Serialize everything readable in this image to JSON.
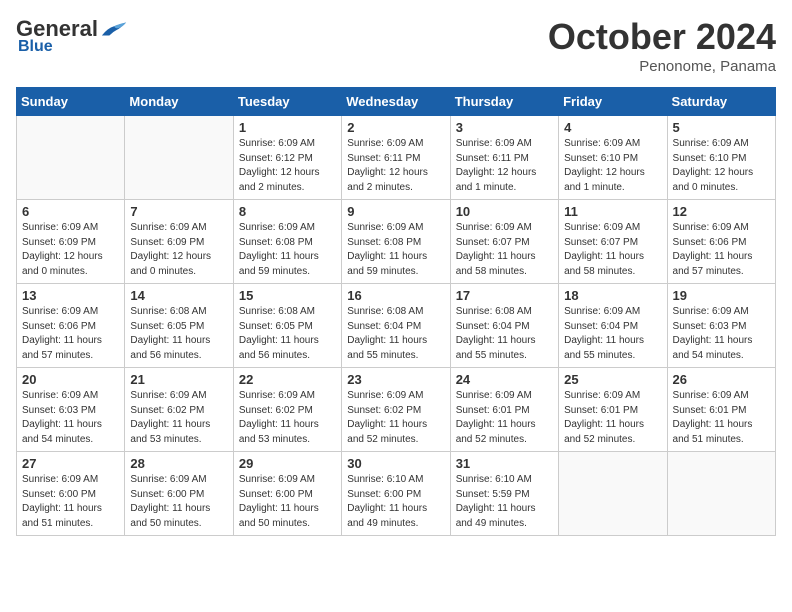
{
  "header": {
    "logo": {
      "general": "General",
      "blue": "Blue"
    },
    "title": "October 2024",
    "location": "Penonome, Panama"
  },
  "weekdays": [
    "Sunday",
    "Monday",
    "Tuesday",
    "Wednesday",
    "Thursday",
    "Friday",
    "Saturday"
  ],
  "weeks": [
    [
      {
        "day": "",
        "info": ""
      },
      {
        "day": "",
        "info": ""
      },
      {
        "day": "1",
        "info": "Sunrise: 6:09 AM\nSunset: 6:12 PM\nDaylight: 12 hours and 2 minutes."
      },
      {
        "day": "2",
        "info": "Sunrise: 6:09 AM\nSunset: 6:11 PM\nDaylight: 12 hours and 2 minutes."
      },
      {
        "day": "3",
        "info": "Sunrise: 6:09 AM\nSunset: 6:11 PM\nDaylight: 12 hours and 1 minute."
      },
      {
        "day": "4",
        "info": "Sunrise: 6:09 AM\nSunset: 6:10 PM\nDaylight: 12 hours and 1 minute."
      },
      {
        "day": "5",
        "info": "Sunrise: 6:09 AM\nSunset: 6:10 PM\nDaylight: 12 hours and 0 minutes."
      }
    ],
    [
      {
        "day": "6",
        "info": "Sunrise: 6:09 AM\nSunset: 6:09 PM\nDaylight: 12 hours and 0 minutes."
      },
      {
        "day": "7",
        "info": "Sunrise: 6:09 AM\nSunset: 6:09 PM\nDaylight: 12 hours and 0 minutes."
      },
      {
        "day": "8",
        "info": "Sunrise: 6:09 AM\nSunset: 6:08 PM\nDaylight: 11 hours and 59 minutes."
      },
      {
        "day": "9",
        "info": "Sunrise: 6:09 AM\nSunset: 6:08 PM\nDaylight: 11 hours and 59 minutes."
      },
      {
        "day": "10",
        "info": "Sunrise: 6:09 AM\nSunset: 6:07 PM\nDaylight: 11 hours and 58 minutes."
      },
      {
        "day": "11",
        "info": "Sunrise: 6:09 AM\nSunset: 6:07 PM\nDaylight: 11 hours and 58 minutes."
      },
      {
        "day": "12",
        "info": "Sunrise: 6:09 AM\nSunset: 6:06 PM\nDaylight: 11 hours and 57 minutes."
      }
    ],
    [
      {
        "day": "13",
        "info": "Sunrise: 6:09 AM\nSunset: 6:06 PM\nDaylight: 11 hours and 57 minutes."
      },
      {
        "day": "14",
        "info": "Sunrise: 6:08 AM\nSunset: 6:05 PM\nDaylight: 11 hours and 56 minutes."
      },
      {
        "day": "15",
        "info": "Sunrise: 6:08 AM\nSunset: 6:05 PM\nDaylight: 11 hours and 56 minutes."
      },
      {
        "day": "16",
        "info": "Sunrise: 6:08 AM\nSunset: 6:04 PM\nDaylight: 11 hours and 55 minutes."
      },
      {
        "day": "17",
        "info": "Sunrise: 6:08 AM\nSunset: 6:04 PM\nDaylight: 11 hours and 55 minutes."
      },
      {
        "day": "18",
        "info": "Sunrise: 6:09 AM\nSunset: 6:04 PM\nDaylight: 11 hours and 55 minutes."
      },
      {
        "day": "19",
        "info": "Sunrise: 6:09 AM\nSunset: 6:03 PM\nDaylight: 11 hours and 54 minutes."
      }
    ],
    [
      {
        "day": "20",
        "info": "Sunrise: 6:09 AM\nSunset: 6:03 PM\nDaylight: 11 hours and 54 minutes."
      },
      {
        "day": "21",
        "info": "Sunrise: 6:09 AM\nSunset: 6:02 PM\nDaylight: 11 hours and 53 minutes."
      },
      {
        "day": "22",
        "info": "Sunrise: 6:09 AM\nSunset: 6:02 PM\nDaylight: 11 hours and 53 minutes."
      },
      {
        "day": "23",
        "info": "Sunrise: 6:09 AM\nSunset: 6:02 PM\nDaylight: 11 hours and 52 minutes."
      },
      {
        "day": "24",
        "info": "Sunrise: 6:09 AM\nSunset: 6:01 PM\nDaylight: 11 hours and 52 minutes."
      },
      {
        "day": "25",
        "info": "Sunrise: 6:09 AM\nSunset: 6:01 PM\nDaylight: 11 hours and 52 minutes."
      },
      {
        "day": "26",
        "info": "Sunrise: 6:09 AM\nSunset: 6:01 PM\nDaylight: 11 hours and 51 minutes."
      }
    ],
    [
      {
        "day": "27",
        "info": "Sunrise: 6:09 AM\nSunset: 6:00 PM\nDaylight: 11 hours and 51 minutes."
      },
      {
        "day": "28",
        "info": "Sunrise: 6:09 AM\nSunset: 6:00 PM\nDaylight: 11 hours and 50 minutes."
      },
      {
        "day": "29",
        "info": "Sunrise: 6:09 AM\nSunset: 6:00 PM\nDaylight: 11 hours and 50 minutes."
      },
      {
        "day": "30",
        "info": "Sunrise: 6:10 AM\nSunset: 6:00 PM\nDaylight: 11 hours and 49 minutes."
      },
      {
        "day": "31",
        "info": "Sunrise: 6:10 AM\nSunset: 5:59 PM\nDaylight: 11 hours and 49 minutes."
      },
      {
        "day": "",
        "info": ""
      },
      {
        "day": "",
        "info": ""
      }
    ]
  ]
}
